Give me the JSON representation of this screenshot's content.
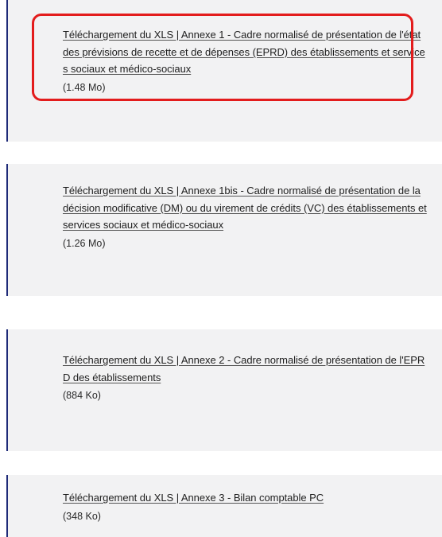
{
  "downloads": [
    {
      "link": "Téléchargement du XLS | Annexe 1 - Cadre normalisé de présentation de l'état des prévisions de recette et de dépenses (EPRD) des établissements et services sociaux et médico-sociaux",
      "size": "(1.48 Mo)"
    },
    {
      "link": "Téléchargement du XLS | Annexe 1bis - Cadre normalisé de présentation de la décision modificative (DM) ou du virement de crédits (VC) des établissements et services sociaux et médico-sociaux",
      "size": "(1.26 Mo)"
    },
    {
      "link": "Téléchargement du XLS | Annexe 2 - Cadre normalisé de présentation de l'EPRD des établissements",
      "size": "(884 Ko)"
    },
    {
      "link": "Téléchargement du XLS | Annexe 3 - Bilan comptable PC",
      "size": "(348 Ko)"
    }
  ],
  "colors": {
    "card_background": "#f2f2f3",
    "card_accent": "#1e2a78",
    "highlight": "#e31c1c"
  }
}
